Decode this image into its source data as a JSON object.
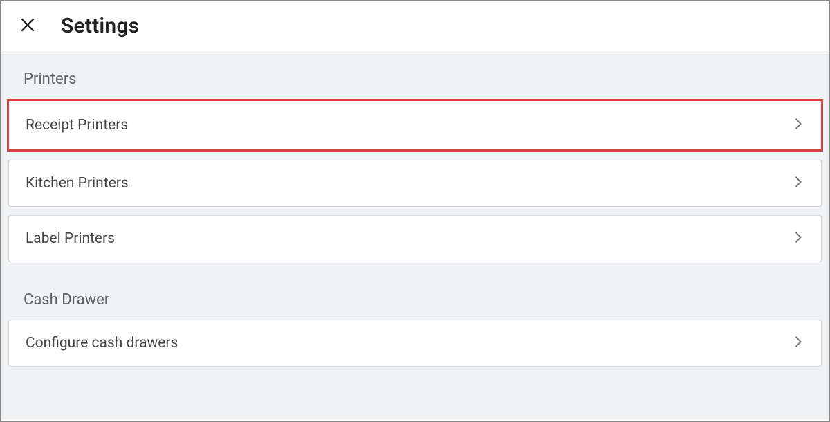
{
  "header": {
    "title": "Settings"
  },
  "sections": {
    "printers": {
      "heading": "Printers",
      "items": [
        {
          "label": "Receipt Printers"
        },
        {
          "label": "Kitchen Printers"
        },
        {
          "label": "Label Printers"
        }
      ]
    },
    "cashDrawer": {
      "heading": "Cash Drawer",
      "items": [
        {
          "label": "Configure cash drawers"
        }
      ]
    }
  }
}
